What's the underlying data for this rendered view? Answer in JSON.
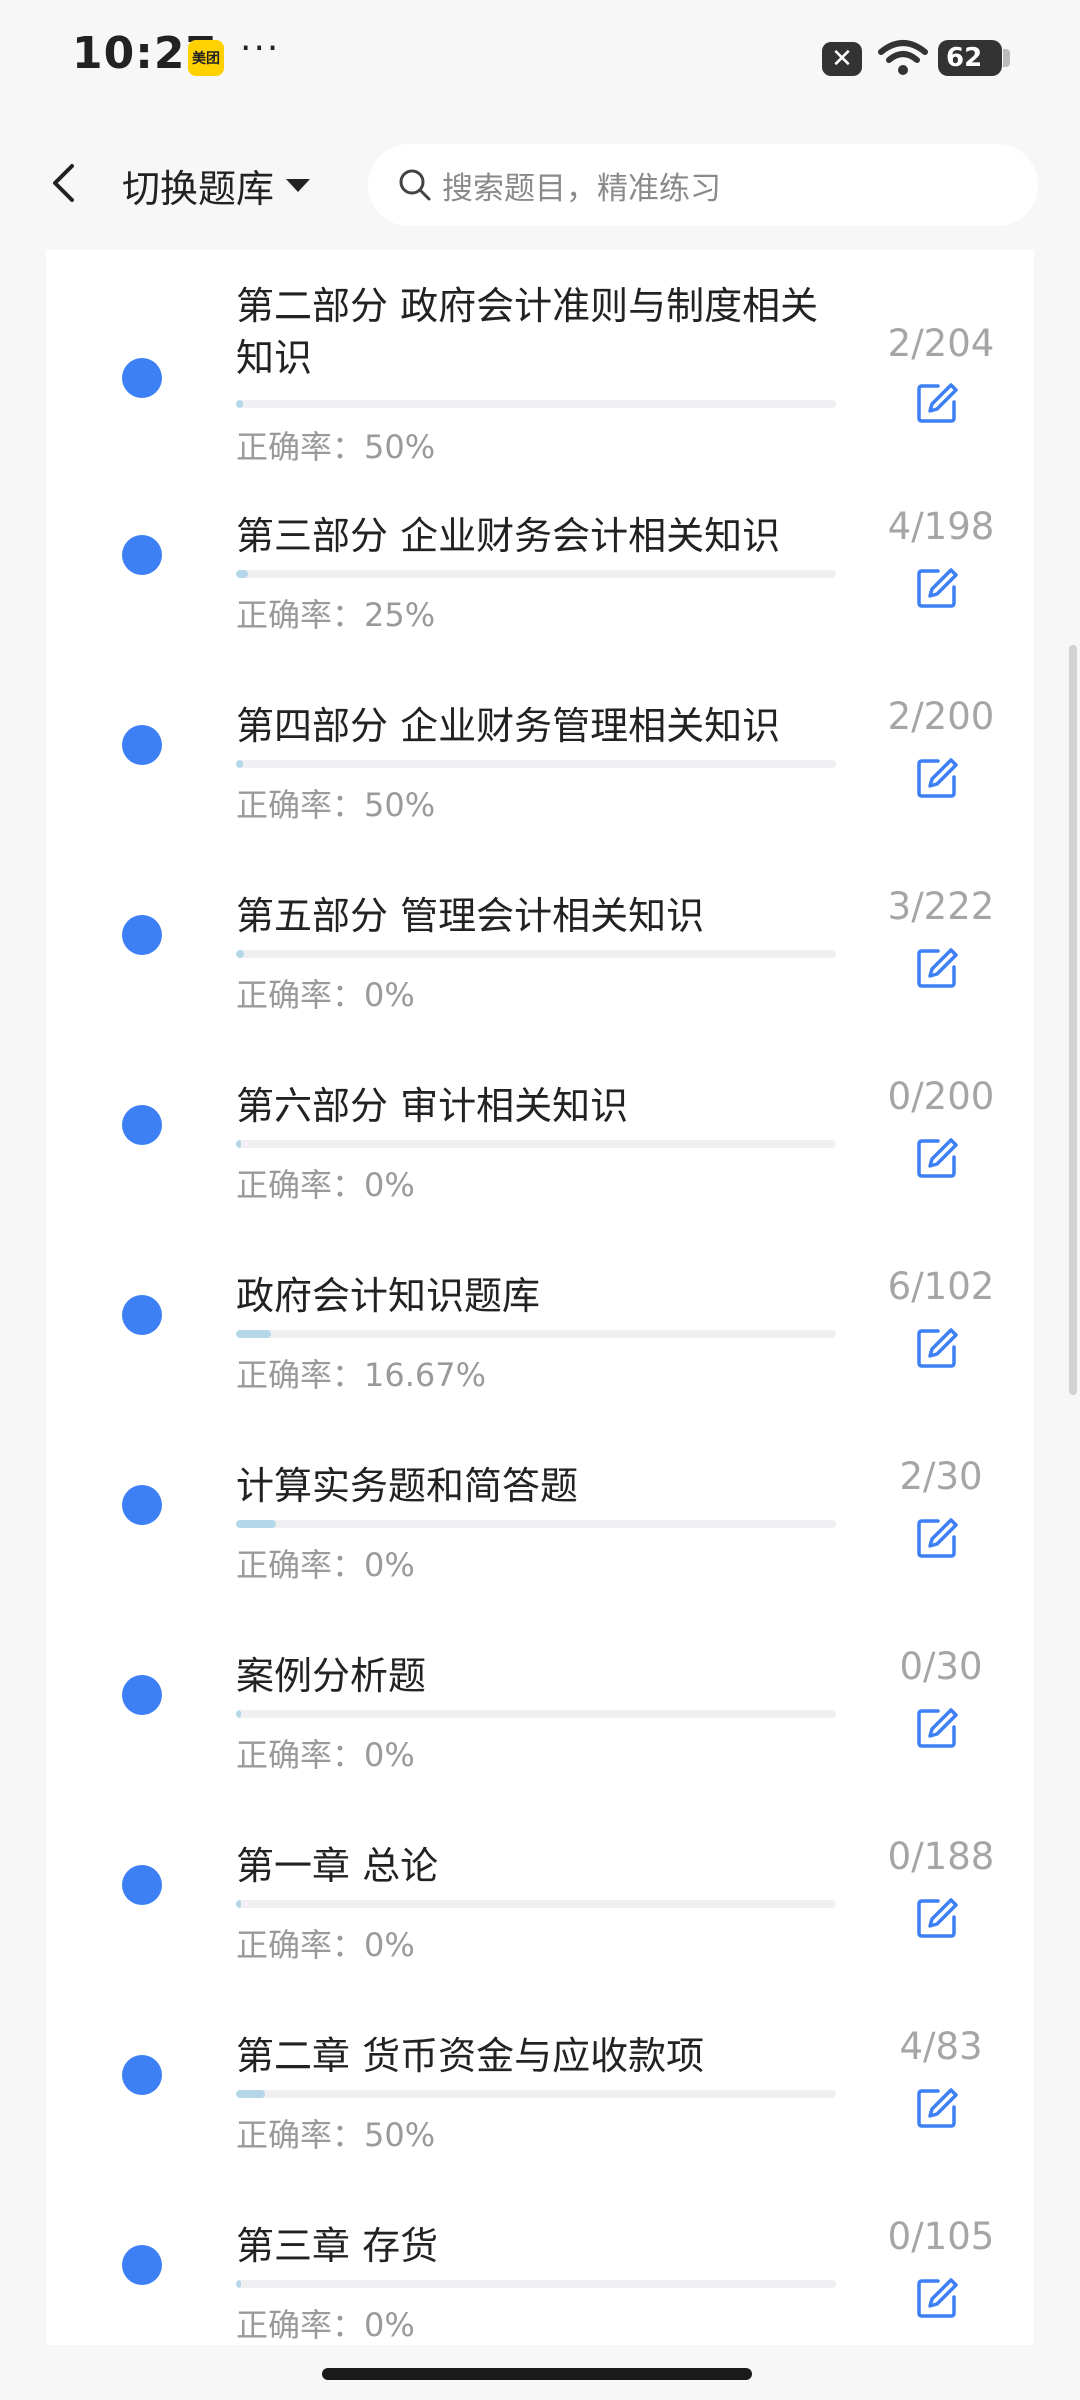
{
  "status_bar": {
    "time": "10:27",
    "app_badge": "美团",
    "dots": "···",
    "battery": "62"
  },
  "header": {
    "switch_label": "切换题库",
    "search_placeholder": "搜索题目，精准练习"
  },
  "items": [
    {
      "title": "第二部分 政府会计准则与制度相关知识",
      "rate": "正确率：50%",
      "count": "2/204",
      "progress": 0.0098
    },
    {
      "title": "第三部分 企业财务会计相关知识",
      "rate": "正确率：25%",
      "count": "4/198",
      "progress": 0.0202
    },
    {
      "title": "第四部分 企业财务管理相关知识",
      "rate": "正确率：50%",
      "count": "2/200",
      "progress": 0.01
    },
    {
      "title": "第五部分 管理会计相关知识",
      "rate": "正确率：0%",
      "count": "3/222",
      "progress": 0.0135
    },
    {
      "title": "第六部分 审计相关知识",
      "rate": "正确率：0%",
      "count": "0/200",
      "progress": 0
    },
    {
      "title": "政府会计知识题库",
      "rate": "正确率：16.67%",
      "count": "6/102",
      "progress": 0.0588
    },
    {
      "title": "计算实务题和简答题",
      "rate": "正确率：0%",
      "count": "2/30",
      "progress": 0.0667
    },
    {
      "title": "案例分析题",
      "rate": "正确率：0%",
      "count": "0/30",
      "progress": 0
    },
    {
      "title": "第一章 总论",
      "rate": "正确率：0%",
      "count": "0/188",
      "progress": 0
    },
    {
      "title": "第二章 货币资金与应收款项",
      "rate": "正确率：50%",
      "count": "4/83",
      "progress": 0.0482
    },
    {
      "title": "第三章 存货",
      "rate": "正确率：0%",
      "count": "0/105",
      "progress": 0
    }
  ],
  "colors": {
    "dot": "#3d7ff5",
    "progress_fill": "#b6d7ea",
    "edit_icon": "#3d7ff5"
  }
}
